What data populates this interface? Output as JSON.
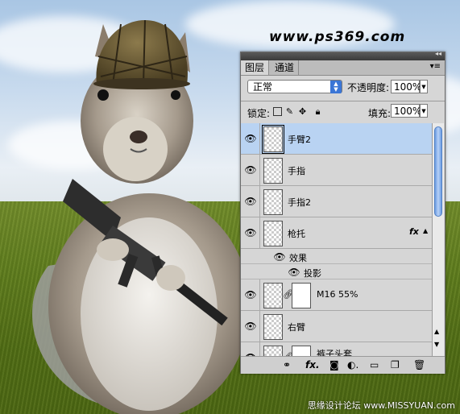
{
  "watermark": "www.ps369.com",
  "credit": "思缘设计论坛 www.MISSYUAN.com",
  "panel": {
    "tabs": [
      {
        "label": "图层"
      },
      {
        "label": "通道"
      }
    ],
    "collapse_icon": "double-chevron-right-icon",
    "menu_icon": "panel-menu-icon",
    "blend_mode": "正常",
    "opacity_label": "不透明度:",
    "opacity_value": "100%",
    "lock_label": "锁定:",
    "fill_label": "填充:",
    "fill_value": "100%"
  },
  "layers": [
    {
      "name": "手臂2",
      "selected": true
    },
    {
      "name": "手指"
    },
    {
      "name": "手指2"
    },
    {
      "name": "枪托",
      "fx": "fx"
    },
    {
      "effect_group": "效果"
    },
    {
      "effect_item": "投影"
    },
    {
      "name": "M16 55%",
      "has_mask": true
    },
    {
      "name": "右臂"
    },
    {
      "name": "裤子头套",
      "has_mask": true
    }
  ]
}
